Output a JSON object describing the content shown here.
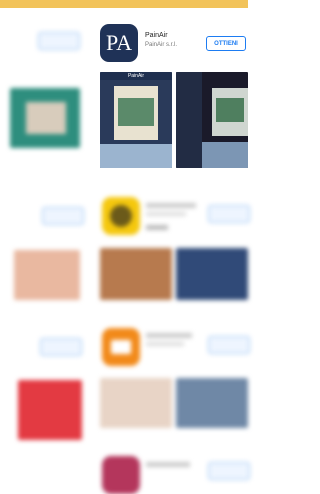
{
  "featured_app": {
    "name": "PainAir",
    "developer": "PainAir s.r.l.",
    "get_label": "OTTIENI",
    "icon_text": "PA"
  },
  "screens": {
    "left_title": "PainAir"
  },
  "colors": {
    "accent": "#1d7cf2",
    "top_bar": "#f2c35a"
  }
}
